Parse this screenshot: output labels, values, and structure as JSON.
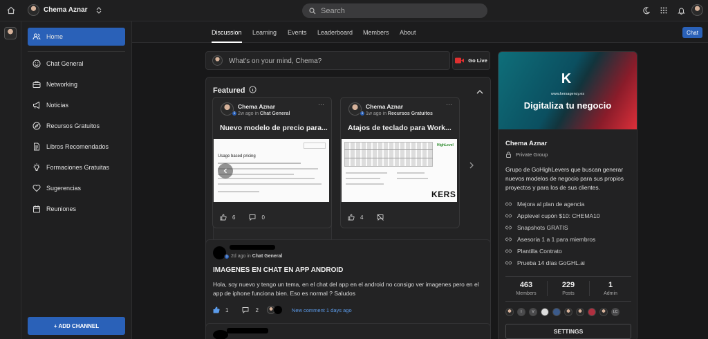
{
  "topbar": {
    "user_name": "Chema Aznar",
    "search_placeholder": "Search"
  },
  "sidebar": {
    "items": [
      {
        "label": "Home",
        "icon": "users-icon"
      },
      {
        "label": "Chat General",
        "icon": "smile-icon"
      },
      {
        "label": "Networking",
        "icon": "briefcase-icon"
      },
      {
        "label": "Noticias",
        "icon": "megaphone-icon"
      },
      {
        "label": "Recursos Gratuitos",
        "icon": "compass-icon"
      },
      {
        "label": "Libros Recomendados",
        "icon": "document-icon"
      },
      {
        "label": "Formaciones Gratuitas",
        "icon": "lightbulb-icon"
      },
      {
        "label": "Sugerencias",
        "icon": "heart-icon"
      },
      {
        "label": "Reuniones",
        "icon": "calendar-icon"
      }
    ],
    "add_channel_label": "+ ADD CHANNEL"
  },
  "tabs": [
    "Discussion",
    "Learning",
    "Events",
    "Leaderboard",
    "Members",
    "About"
  ],
  "chat_button": "Chat",
  "composer": {
    "placeholder": "What's on your mind, Chema?",
    "go_live": "Go Live"
  },
  "featured": {
    "title": "Featured",
    "posts": [
      {
        "author": "Chema Aznar",
        "meta_time": "2w ago in",
        "meta_channel": "Chat General",
        "title": "Nuevo modelo de precio para...",
        "likes": "6",
        "comments": "0",
        "preview_heading": "Usage based pricing"
      },
      {
        "author": "Chema Aznar",
        "meta_time": "1w ago in",
        "meta_channel": "Recursos Gratuitos",
        "title": "Atajos de teclado para Work...",
        "likes": "4",
        "preview_brand": "HighLevel",
        "preview_logo": "KERS"
      }
    ]
  },
  "post": {
    "meta_time": "2d ago in",
    "meta_channel": "Chat General",
    "title": "IMAGENES EN CHAT EN APP ANDROID",
    "body": "Hola, soy nuevo y tengo un tema, en el chat del app en el android no consigo ver imagenes pero en el app de iphone funciona bien. Eso es normal ? Saludos",
    "likes": "1",
    "comments": "2",
    "new_comment": "New comment 1 days ago"
  },
  "group": {
    "banner_url_text": "www.kersagency.es",
    "banner_headline": "Digitaliza tu negocio",
    "name": "Chema Aznar",
    "privacy": "Private Group",
    "description": "Grupo de GoHighLevers que buscan generar nuevos modelos de negocio para sus propios proyectos y para los de sus clientes.",
    "links": [
      "Mejora al plan de agencia",
      "Applevel cupón $10: CHEMA10",
      "Snapshots GRATIS",
      "Asesoria 1 a 1 para miembros",
      "Plantilla Contrato",
      "Prueba 14 días GoGHL.ai"
    ],
    "stats": [
      {
        "value": "463",
        "label": "Members"
      },
      {
        "value": "229",
        "label": "Posts"
      },
      {
        "value": "1",
        "label": "Admin"
      }
    ],
    "member_initials": [
      "I",
      "V",
      "LC"
    ],
    "settings_label": "SETTINGS"
  },
  "colors": {
    "accent": "#2a61b8",
    "live_red": "#e03030",
    "link_blue": "#5b9bea"
  }
}
